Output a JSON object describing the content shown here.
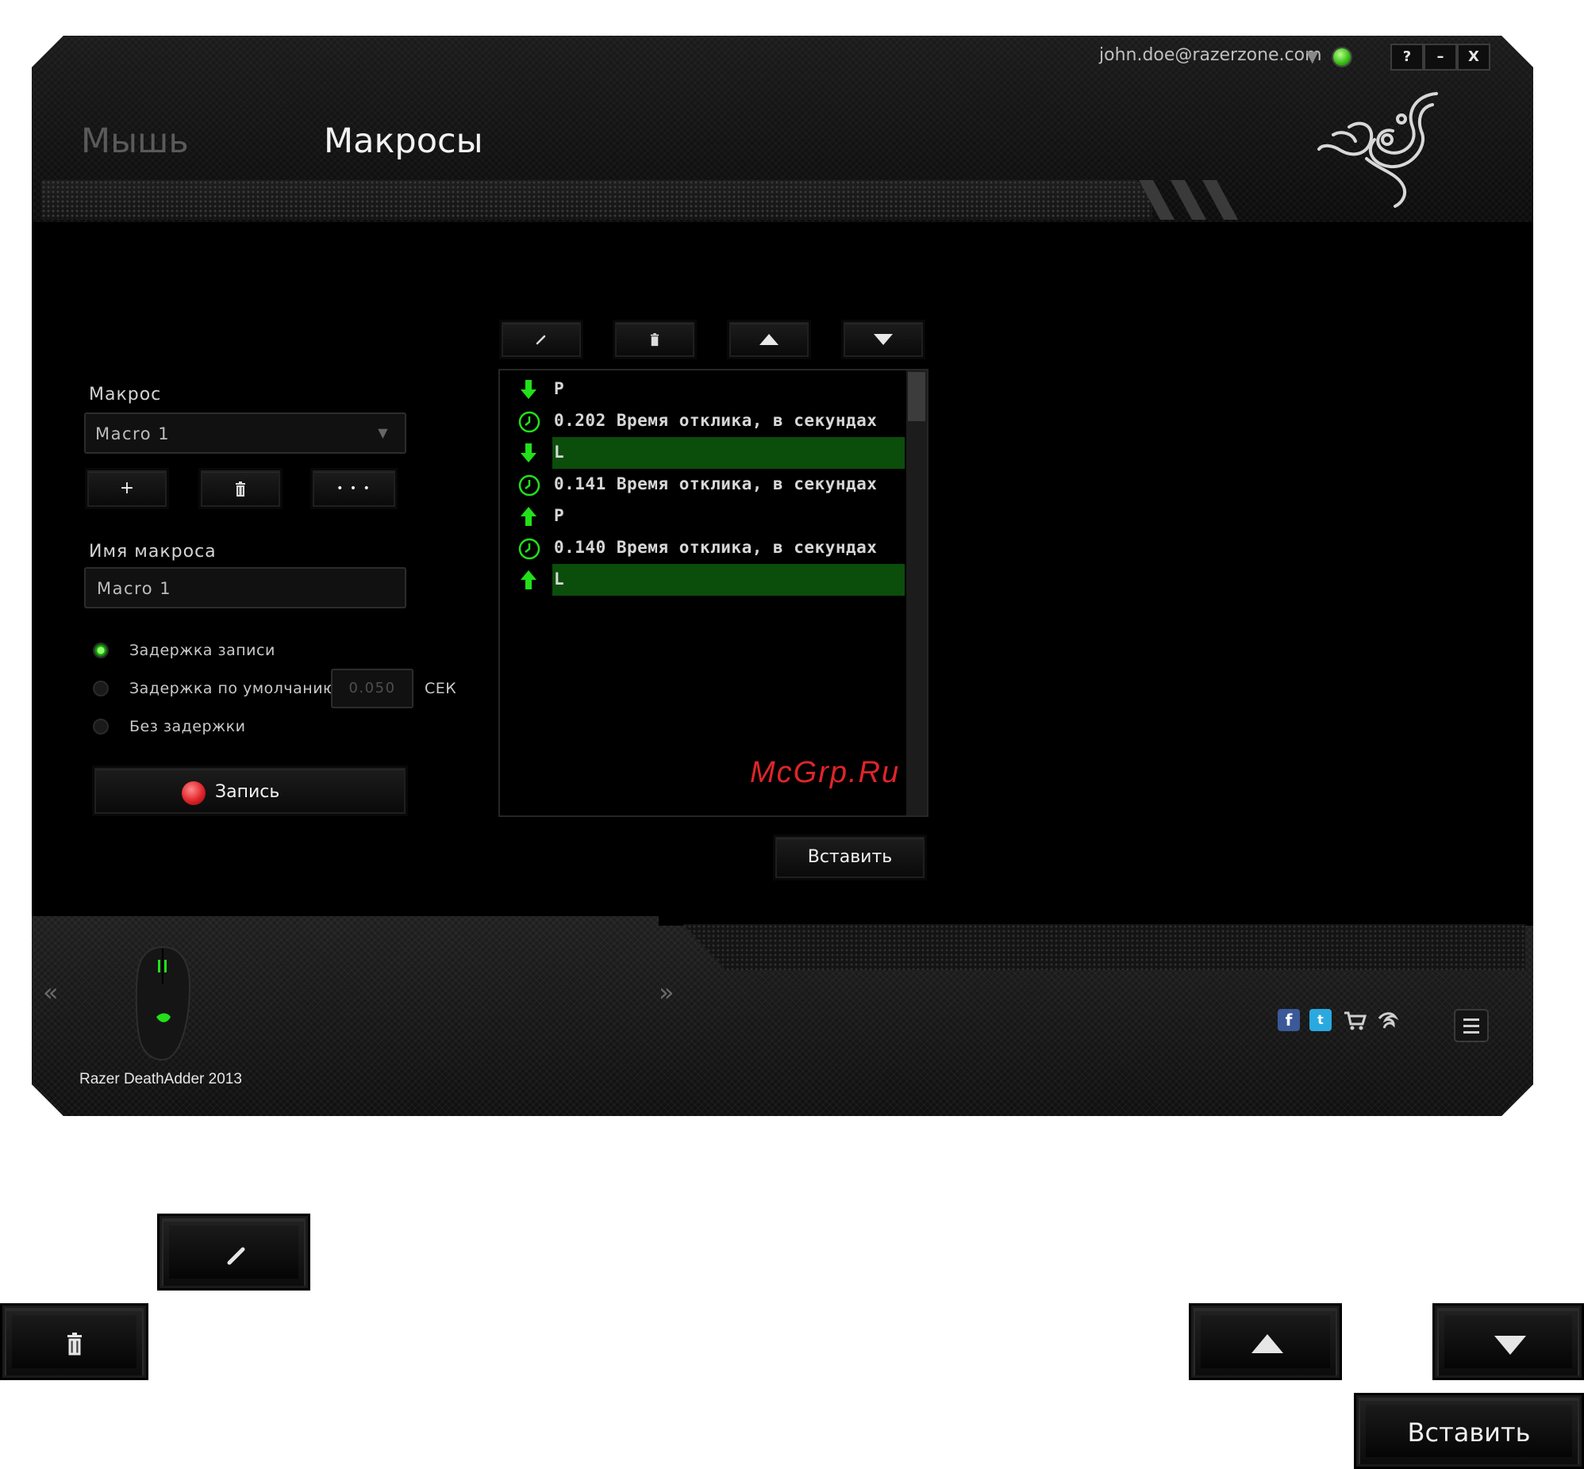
{
  "window": {
    "tabs": [
      {
        "label": "Мышь",
        "active": false
      },
      {
        "label": "Макросы",
        "active": true
      }
    ],
    "user_email": "john.doe@razerzone.com",
    "controls": {
      "help": "?",
      "minimize": "–",
      "close": "X"
    }
  },
  "macro_panel": {
    "macro_label": "Макрос",
    "macro_select_value": "Macro 1",
    "add_button": "+",
    "more_button": "• • •",
    "name_label": "Имя макроса",
    "name_value": "Macro 1",
    "delay_options": [
      {
        "label": "Задержка записи",
        "selected": true
      },
      {
        "label": "Задержка по умолчанию",
        "selected": false
      },
      {
        "label": "Без задержки",
        "selected": false
      }
    ],
    "default_delay_value": "0.050",
    "delay_unit": "СЕК",
    "record_button": "Запись"
  },
  "macro_list": {
    "rows": [
      {
        "icon": "arrow-down-icon",
        "text": "P",
        "selected": false
      },
      {
        "icon": "clock-icon",
        "text": "0.202 Время отклика, в секундах",
        "selected": false
      },
      {
        "icon": "arrow-down-icon",
        "text": "L",
        "selected": true
      },
      {
        "icon": "clock-icon",
        "text": "0.141 Время отклика, в секундах",
        "selected": false
      },
      {
        "icon": "arrow-up-icon",
        "text": "P",
        "selected": false
      },
      {
        "icon": "clock-icon",
        "text": "0.140 Время отклика, в секундах",
        "selected": false
      },
      {
        "icon": "arrow-up-icon",
        "text": "L",
        "selected": true
      }
    ],
    "insert_button": "Вставить"
  },
  "footer": {
    "device_name": "Razer DeathAdder 2013",
    "prev_arrow": "«",
    "next_arrow": "»"
  },
  "watermark": "McGrp.Ru",
  "legend_buttons": {
    "insert_button": "Вставить"
  },
  "colors": {
    "accent_green": "#0b4d0b",
    "icon_green": "#22e01a",
    "record_red": "#e0242a"
  }
}
